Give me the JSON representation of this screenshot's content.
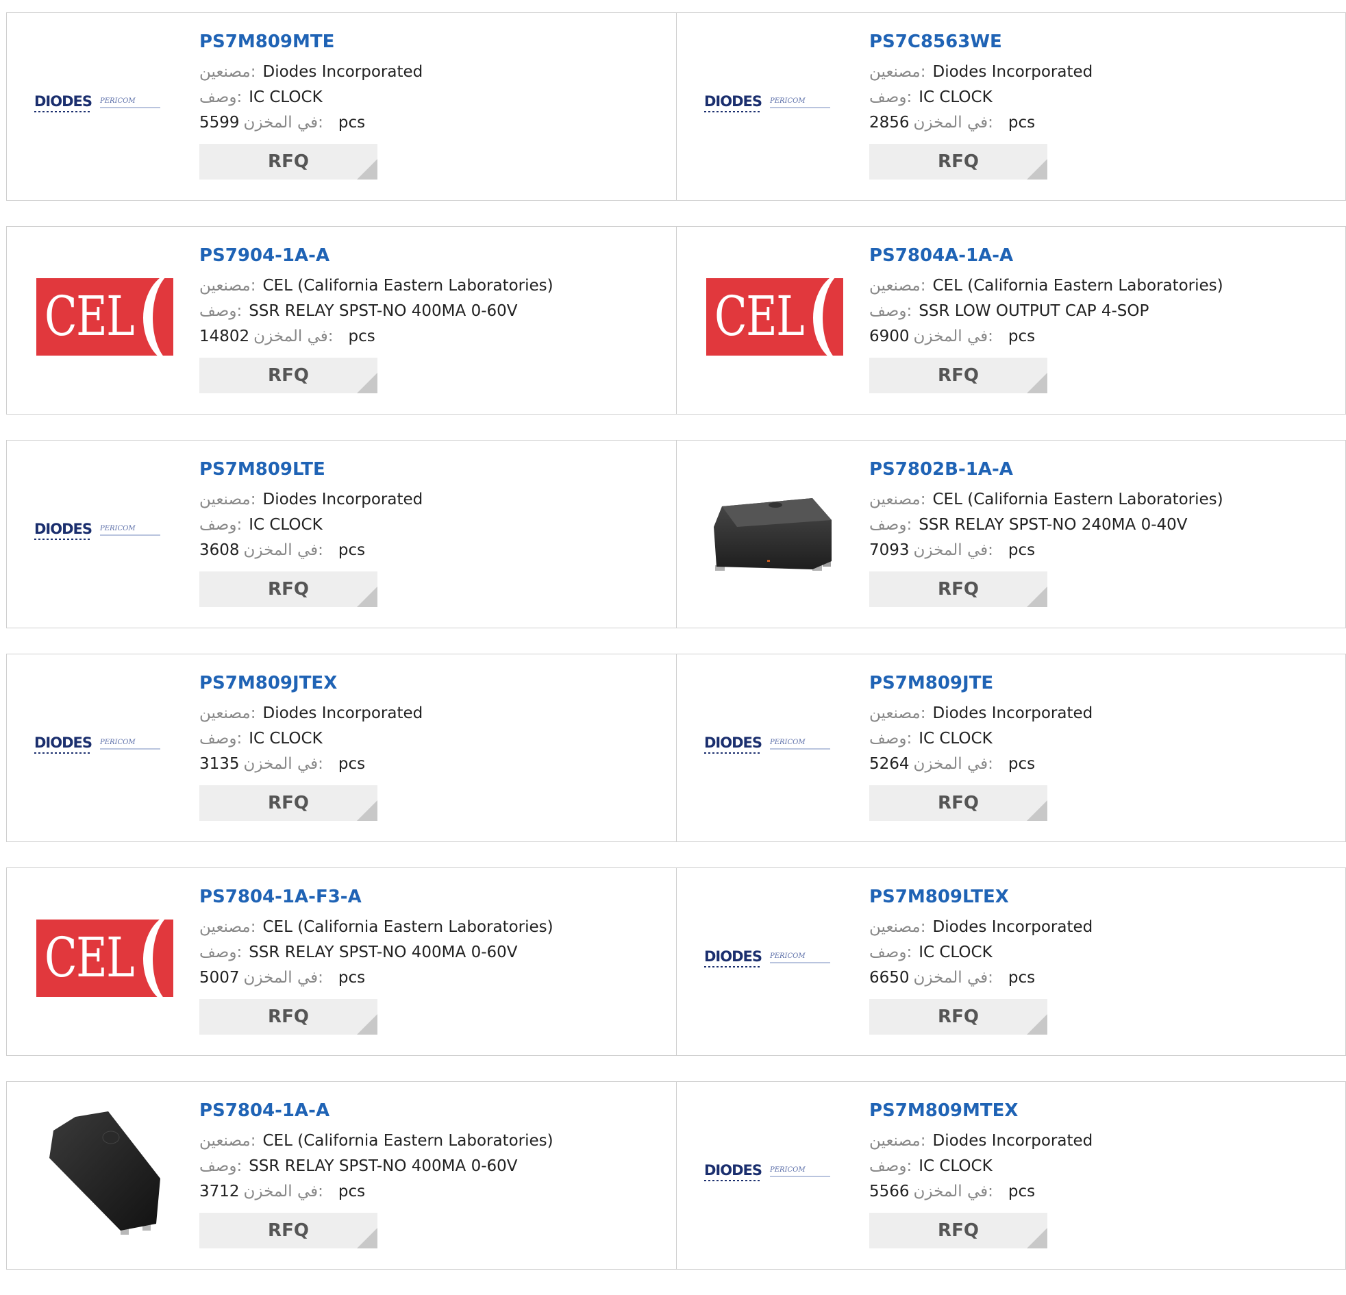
{
  "labels": {
    "manufacturer": ":مصنعين",
    "description": ":وصف",
    "stock": ":في المخزن",
    "unit": "pcs",
    "rfq": "RFQ"
  },
  "colors": {
    "part_link": "#1f63b5",
    "cel_red": "#e1383d",
    "diodes_navy": "#1b2f6e",
    "button_bg": "#eeeeee"
  },
  "products": [
    {
      "part": "PS7M809MTE",
      "manufacturer": "Diodes Incorporated",
      "description": "IC CLOCK",
      "stock": "5599",
      "image": "diodes-pericom-logo",
      "logo_text": "DIODES",
      "logo_sub": "PERICOM"
    },
    {
      "part": "PS7C8563WE",
      "manufacturer": "Diodes Incorporated",
      "description": "IC CLOCK",
      "stock": "2856",
      "image": "diodes-pericom-logo",
      "logo_text": "DIODES",
      "logo_sub": "PERICOM"
    },
    {
      "part": "PS7904-1A-A",
      "manufacturer": "CEL (California Eastern Laboratories)",
      "description": "SSR RELAY SPST-NO 400MA 0-60V",
      "stock": "14802",
      "image": "cel-logo",
      "logo_text": "CEL"
    },
    {
      "part": "PS7804A-1A-A",
      "manufacturer": "CEL (California Eastern Laboratories)",
      "description": "SSR LOW OUTPUT CAP 4-SOP",
      "stock": "6900",
      "image": "cel-logo",
      "logo_text": "CEL"
    },
    {
      "part": "PS7M809LTE",
      "manufacturer": "Diodes Incorporated",
      "description": "IC CLOCK",
      "stock": "3608",
      "image": "diodes-pericom-logo",
      "logo_text": "DIODES",
      "logo_sub": "PERICOM"
    },
    {
      "part": "PS7802B-1A-A",
      "manufacturer": "CEL (California Eastern Laboratories)",
      "description": "SSR RELAY SPST-NO 240MA 0-40V",
      "stock": "7093",
      "image": "chip-photo-rect"
    },
    {
      "part": "PS7M809JTEX",
      "manufacturer": "Diodes Incorporated",
      "description": "IC CLOCK",
      "stock": "3135",
      "image": "diodes-pericom-logo",
      "logo_text": "DIODES",
      "logo_sub": "PERICOM"
    },
    {
      "part": "PS7M809JTE",
      "manufacturer": "Diodes Incorporated",
      "description": "IC CLOCK",
      "stock": "5264",
      "image": "diodes-pericom-logo",
      "logo_text": "DIODES",
      "logo_sub": "PERICOM"
    },
    {
      "part": "PS7804-1A-F3-A",
      "manufacturer": "CEL (California Eastern Laboratories)",
      "description": "SSR RELAY SPST-NO 400MA 0-60V",
      "stock": "5007",
      "image": "cel-logo",
      "logo_text": "CEL"
    },
    {
      "part": "PS7M809LTEX",
      "manufacturer": "Diodes Incorporated",
      "description": "IC CLOCK",
      "stock": "6650",
      "image": "diodes-pericom-logo",
      "logo_text": "DIODES",
      "logo_sub": "PERICOM"
    },
    {
      "part": "PS7804-1A-A",
      "manufacturer": "CEL (California Eastern Laboratories)",
      "description": "SSR RELAY SPST-NO 400MA 0-60V",
      "stock": "3712",
      "image": "chip-photo-small"
    },
    {
      "part": "PS7M809MTEX",
      "manufacturer": "Diodes Incorporated",
      "description": "IC CLOCK",
      "stock": "5566",
      "image": "diodes-pericom-logo",
      "logo_text": "DIODES",
      "logo_sub": "PERICOM"
    }
  ]
}
